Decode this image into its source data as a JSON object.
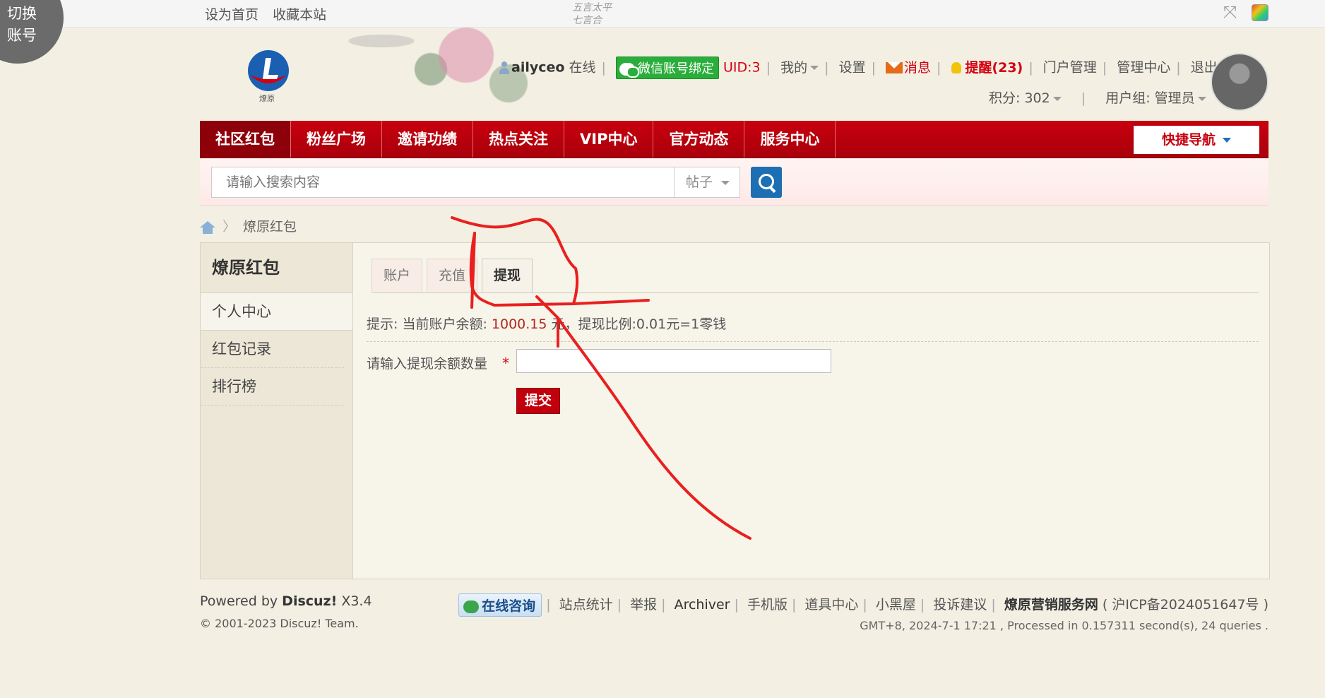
{
  "corner": {
    "line1": "切换",
    "line2": "账号"
  },
  "topbar": {
    "set_home": "设为首页",
    "bookmark": "收藏本站"
  },
  "header": {
    "floral_text": "五言太平\n七言合",
    "logo_caption": "燎原"
  },
  "userbar": {
    "username": "ailyceo",
    "online": "在线",
    "wechat_bind": "微信账号绑定",
    "uid": "UID:3",
    "mine": "我的",
    "settings": "设置",
    "messages": "消息",
    "reminders": "提醒(23)",
    "portal_manage": "门户管理",
    "admin_center": "管理中心",
    "logout": "退出",
    "points": "积分: 302",
    "user_group": "用户组: 管理员"
  },
  "nav": {
    "items": [
      "社区红包",
      "粉丝广场",
      "邀请功绩",
      "热点关注",
      "VIP中心",
      "官方动态",
      "服务中心"
    ],
    "quick_nav": "快捷导航"
  },
  "search": {
    "placeholder": "请输入搜索内容",
    "type": "帖子"
  },
  "breadcrumb": {
    "current": "燎原红包"
  },
  "sidebar": {
    "title": "燎原红包",
    "items": [
      "个人中心",
      "红包记录",
      "排行榜"
    ]
  },
  "tabs": [
    "账户",
    "充值",
    "提现"
  ],
  "withdraw": {
    "tip_prefix": "提示: 当前账户余额: ",
    "balance": "1000.15",
    "tip_suffix": " 元，提现比例:0.01元=1零钱",
    "label": "请输入提现余额数量",
    "required": "*",
    "submit": "提交"
  },
  "footer": {
    "powered_prefix": "Powered by ",
    "brand": "Discuz!",
    "version": " X3.4",
    "copyright": "© 2001-2023 Discuz! Team.",
    "consult": "在线咨询",
    "links": [
      "站点统计",
      "举报",
      "Archiver",
      "手机版",
      "道具中心",
      "小黑屋",
      "投诉建议"
    ],
    "site_name": "燎原营销服务网",
    "icp": "( 沪ICP备2024051647号 )",
    "meta": "GMT+8, 2024-7-1 17:21 , Processed in 0.157311 second(s), 24 queries ."
  },
  "colors": {
    "nav_red": "#c8000e",
    "accent_blue": "#1c6fb3",
    "annotation_red": "#e8201f"
  },
  "icons": [
    "person-icon",
    "wechat-icon",
    "mail-icon",
    "bulb-icon",
    "home-icon",
    "search-icon",
    "expand-icon",
    "color-icon"
  ]
}
